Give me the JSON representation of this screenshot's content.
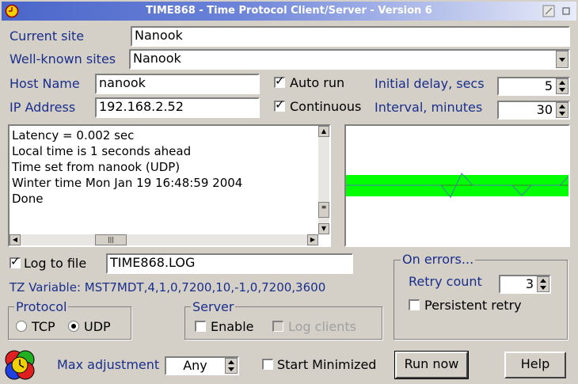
{
  "window": {
    "title": "TIME868 - Time Protocol Client/Server - Version 6"
  },
  "site": {
    "current_label": "Current site",
    "current_value": "Nanook",
    "known_label": "Well-known sites",
    "known_value": "Nanook"
  },
  "host": {
    "name_label": "Host Name",
    "name_value": "nanook",
    "ip_label": "IP Address",
    "ip_value": "192.168.2.52"
  },
  "options": {
    "auto_run_label": "Auto run",
    "auto_run_checked": true,
    "continuous_label": "Continuous",
    "continuous_checked": true,
    "initial_delay_label": "Initial delay, secs",
    "initial_delay_value": "5",
    "interval_label": "Interval, minutes",
    "interval_value": "30"
  },
  "log": {
    "lines": [
      "Latency = 0.002 sec",
      "Local time is      1 seconds ahead",
      "Time set from nanook (UDP)",
      "Winter time Mon Jan 19 16:48:59 2004",
      "Done"
    ]
  },
  "graph": {
    "band_color": "#00ff00",
    "line_color": "#5a8a5a"
  },
  "log_file": {
    "label": "Log to file",
    "checked": true,
    "value": "TIME868.LOG"
  },
  "tz": {
    "text": "TZ Variable: MST7MDT,4,1,0,7200,10,-1,0,7200,3600"
  },
  "errors": {
    "title": "On errors...",
    "retry_label": "Retry count",
    "retry_value": "3",
    "persistent_label": "Persistent retry",
    "persistent_checked": false
  },
  "protocol": {
    "title": "Protocol",
    "tcp_label": "TCP",
    "udp_label": "UDP",
    "selected": "UDP"
  },
  "server": {
    "title": "Server",
    "enable_label": "Enable",
    "log_clients_label": "Log clients"
  },
  "bottom": {
    "max_adj_label": "Max adjustment",
    "max_adj_value": "Any",
    "start_min_label": "Start Minimized",
    "run_now_label": "Run now",
    "help_label": "Help"
  },
  "colors": {
    "label_blue": "#1a2e8c",
    "title_blue": "#4a66c8"
  }
}
